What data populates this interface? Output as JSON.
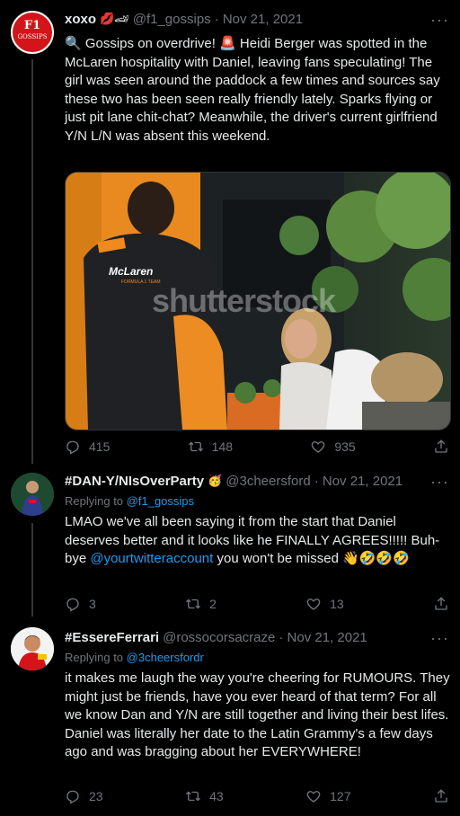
{
  "tweets": [
    {
      "name": "xoxo",
      "name_emoji": "💋🏎",
      "handle": "@f1_gossips",
      "date": "· Nov 21, 2021",
      "avatar_text_top": "F1",
      "avatar_text_bottom": "GOSSIPS",
      "body_parts": [
        "🔍 Gossips on overdrive! 🚨  Heidi Berger was spotted in the McLaren hospitality with Daniel, leaving fans speculating! The girl was seen around the paddock a few times and sources say these two has been seen really friendly lately. Sparks flying or just pit lane chit-chat? Meanwhile, the driver's current girlfriend Y/N L/N was absent this weekend."
      ],
      "image": {
        "shirt_text": "McLaren",
        "shirt_subtext": "FORMULA 1 TEAM",
        "watermark": "shutterstock"
      },
      "replies": "415",
      "retweets": "148",
      "likes": "935"
    },
    {
      "name": "#DAN-Y/NIsOverParty",
      "name_emoji": "🥳",
      "handle": "@3cheersford",
      "date": "· Nov 21, 2021",
      "replying_label": "Replying to",
      "replying_to": "@f1_gossips",
      "body_start": "LMAO we've all been saying it from the start that Daniel deserves better and it looks like he FINALLY AGREES!!!!! Buh-bye ",
      "body_link": "@yourtwitteraccount",
      "body_end": " you won't be missed 👋🤣🤣🤣",
      "replies": "3",
      "retweets": "2",
      "likes": "13"
    },
    {
      "name": "#EssereFerrari",
      "handle": "@rossocorsacraze",
      "date": "· Nov 21, 2021",
      "replying_label": "Replying to",
      "replying_to": "@3cheersfordr",
      "body": "it makes me laugh the way you're cheering for RUMOURS. They might just be friends, have you ever heard of that term? For all we know Dan and Y/N are still together and living their best lifes. Daniel was literally her date to the Latin Grammy's a few days ago and was bragging about her EVERYWHERE!",
      "replies": "23",
      "retweets": "43",
      "likes": "127"
    }
  ],
  "more_label": "···",
  "colors": {
    "background": "#000000",
    "text": "#e7e9ea",
    "muted": "#71767b",
    "link": "#1d9bf0",
    "divider": "#2f3336"
  }
}
